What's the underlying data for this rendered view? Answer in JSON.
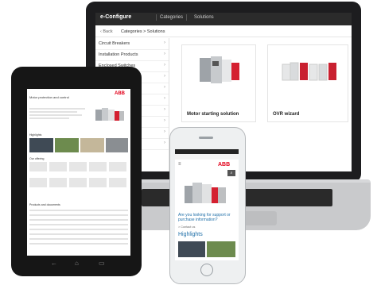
{
  "laptop": {
    "app_title": "e-Configure",
    "tabs": [
      "Categories",
      "Solutions"
    ],
    "back_label": "Back",
    "breadcrumb": "Categories > Solutions",
    "sidebar": [
      {
        "label": "Circuit Breakers"
      },
      {
        "label": "Installation Products"
      },
      {
        "label": "Enclosed Switches"
      },
      {
        "label": ""
      },
      {
        "label": ""
      },
      {
        "label": ""
      },
      {
        "label": ""
      },
      {
        "label": ""
      },
      {
        "label": ""
      },
      {
        "label": ""
      }
    ],
    "cards": [
      {
        "caption": "Motor starting solution"
      },
      {
        "caption": "OVR wizard"
      }
    ]
  },
  "tablet": {
    "page_title": "Motor protection and control",
    "logo": "ABB",
    "section_highlights": "Highlights",
    "section_offering": "Our offering",
    "section_downloads": "Products and documents",
    "nav_icons": [
      "back-icon",
      "home-icon",
      "recent-apps-icon"
    ]
  },
  "phone": {
    "logo": "ABB",
    "question": "Are you looking for support or purchase information?",
    "contact_link": "> Contact us",
    "highlights": "Highlights",
    "search_icon": "search-icon",
    "menu_icon": "menu-icon"
  },
  "colors": {
    "abb_red": "#e2001a",
    "link_blue": "#1f6fa8",
    "topbar": "#2b2b2b"
  }
}
